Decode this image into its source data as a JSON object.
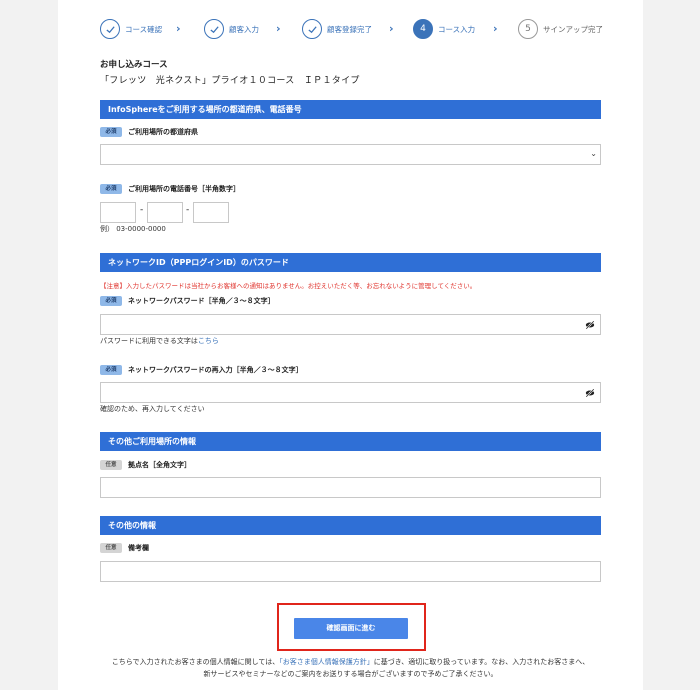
{
  "stepper": {
    "steps": [
      {
        "label": "コース確認",
        "state": "done"
      },
      {
        "label": "顧客入力",
        "state": "done"
      },
      {
        "label": "顧客登録完了",
        "state": "done"
      },
      {
        "label": "コース入力",
        "state": "current",
        "number": "4"
      },
      {
        "label": "サインアップ完了",
        "state": "future",
        "number": "5"
      }
    ]
  },
  "course": {
    "heading": "お申し込みコース",
    "name": "「フレッツ　光ネクスト」プライオ１０コース　ＩＰ１タイプ"
  },
  "badges": {
    "required": "必須",
    "optional": "任意"
  },
  "section1": {
    "title": "InfoSphereをご利用する場所の都道府県、電話番号",
    "prefecture_label": "ご利用場所の都道府県",
    "prefecture_value": "",
    "phone_label": "ご利用場所の電話番号［半角数字］",
    "phone_sep": "-",
    "phone_example": "例） 03-0000-0000"
  },
  "section2": {
    "title": "ネットワークID（PPPログインID）のパスワード",
    "warning": "【注意】入力したパスワードは当社からお客様への通知はありません。お控えいただく等、お忘れないように管理してください。",
    "password_label": "ネットワークパスワード［半角／３～８文字］",
    "password_note": "パスワードに利用できる文字は",
    "password_note_link": "こちら",
    "confirm_label": "ネットワークパスワードの再入力［半角／３～８文字］",
    "confirm_note": "確認のため、再入力してください"
  },
  "section3": {
    "title": "その他ご利用場所の情報",
    "site_label": "拠点名［全角文字］"
  },
  "section4": {
    "title": "その他の情報",
    "remarks_label": "備考欄"
  },
  "actions": {
    "confirm_button": "確認画面に進む"
  },
  "footer": {
    "line1_pre": "こちらで入力されたお客さまの個人情報に関しては、",
    "line1_link": "「お客さま個人情報保護方針」",
    "line1_post": "に基づき、適切に取り扱っています。なお、入力されたお客さまへ、",
    "line2": "新サービスやセミナーなどのご案内をお送りする場合がございますので予めご了承ください。"
  },
  "colors": {
    "accent": "#2f6fd6",
    "warning": "#e0342e",
    "highlight": "#e0251b"
  }
}
